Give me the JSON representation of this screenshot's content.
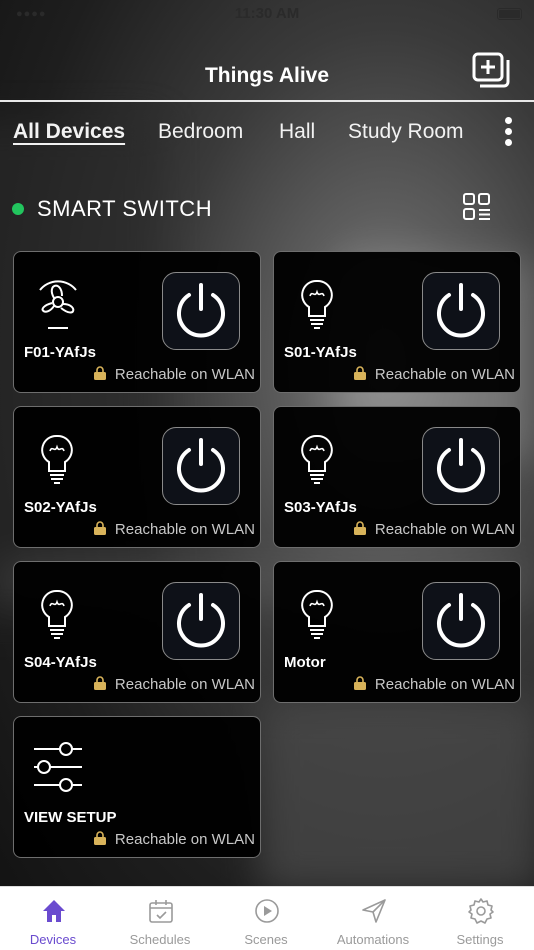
{
  "status_bar": {
    "time": "11:30 AM"
  },
  "header": {
    "title": "Things Alive",
    "add_icon": "add-device-icon"
  },
  "tabs": [
    {
      "label": "All Devices",
      "active": true
    },
    {
      "label": "Bedroom",
      "active": false
    },
    {
      "label": "Hall",
      "active": false
    },
    {
      "label": "Study Room",
      "active": false
    }
  ],
  "section": {
    "title": "SMART SWITCH",
    "status_color": "#22c55e"
  },
  "devices": [
    {
      "name": "F01-YAfJs",
      "icon": "fan-icon",
      "status": "Reachable on WLAN"
    },
    {
      "name": "S01-YAfJs",
      "icon": "bulb-icon",
      "status": "Reachable on WLAN"
    },
    {
      "name": "S02-YAfJs",
      "icon": "bulb-icon",
      "status": "Reachable on WLAN"
    },
    {
      "name": "S03-YAfJs",
      "icon": "bulb-icon",
      "status": "Reachable on WLAN"
    },
    {
      "name": "S04-YAfJs",
      "icon": "bulb-icon",
      "status": "Reachable on WLAN"
    },
    {
      "name": "Motor",
      "icon": "bulb-icon",
      "status": "Reachable on WLAN"
    },
    {
      "name": "VIEW SETUP",
      "icon": "sliders-icon",
      "status": "Reachable on WLAN"
    }
  ],
  "bottom_nav": [
    {
      "label": "Devices",
      "icon": "home-icon",
      "active": true
    },
    {
      "label": "Schedules",
      "icon": "calendar-icon",
      "active": false
    },
    {
      "label": "Scenes",
      "icon": "play-icon",
      "active": false
    },
    {
      "label": "Automations",
      "icon": "send-icon",
      "active": false
    },
    {
      "label": "Settings",
      "icon": "gear-icon",
      "active": false
    }
  ],
  "colors": {
    "accent": "#6a4bcf",
    "online": "#22c55e",
    "lock": "#d8b35a"
  }
}
